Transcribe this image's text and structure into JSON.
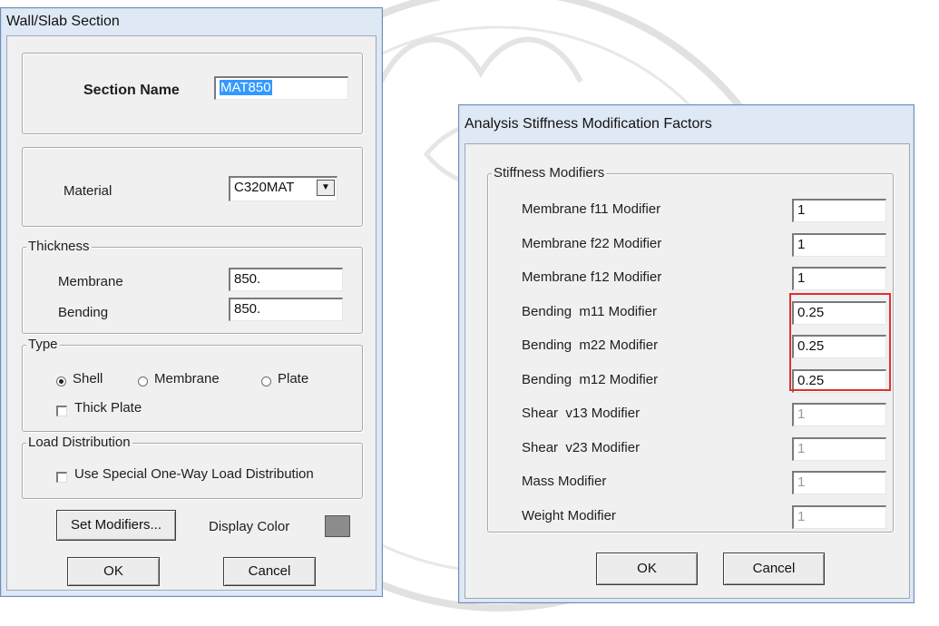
{
  "wall_slab": {
    "title": "Wall/Slab Section",
    "section_name_label": "Section Name",
    "section_name_value": "MAT850",
    "material_label": "Material",
    "material_value": "C320MAT",
    "thickness_title": "Thickness",
    "membrane_label": "Membrane",
    "membrane_value": "850.",
    "bending_label": "Bending",
    "bending_value": "850.",
    "type_title": "Type",
    "type_options": [
      "Shell",
      "Membrane",
      "Plate"
    ],
    "type_selected": "Shell",
    "thick_plate_label": "Thick Plate",
    "load_dist_title": "Load Distribution",
    "load_dist_option": "Use Special One-Way Load Distribution",
    "set_modifiers_label": "Set Modifiers...",
    "display_color_label": "Display Color",
    "display_color": "#8c8c8c",
    "ok_label": "OK",
    "cancel_label": "Cancel"
  },
  "stiffness": {
    "title": "Analysis Stiffness Modification Factors",
    "group_title": "Stiffness Modifiers",
    "rows": [
      {
        "label": "Membrane f11 Modifier",
        "value": "1"
      },
      {
        "label": "Membrane f22 Modifier",
        "value": "1"
      },
      {
        "label": "Membrane f12 Modifier",
        "value": "1"
      },
      {
        "label": "Bending  m11 Modifier",
        "value": "0.25"
      },
      {
        "label": "Bending  m22 Modifier",
        "value": "0.25"
      },
      {
        "label": "Bending  m12 Modifier",
        "value": "0.25"
      },
      {
        "label": "Shear  v13 Modifier",
        "value": "1"
      },
      {
        "label": "Shear  v23 Modifier",
        "value": "1"
      },
      {
        "label": "Mass Modifier",
        "value": "1"
      },
      {
        "label": "Weight Modifier",
        "value": "1"
      }
    ],
    "ok_label": "OK",
    "cancel_label": "Cancel"
  },
  "colors": {
    "highlight": "#e03030",
    "selection": "#3399ff"
  }
}
